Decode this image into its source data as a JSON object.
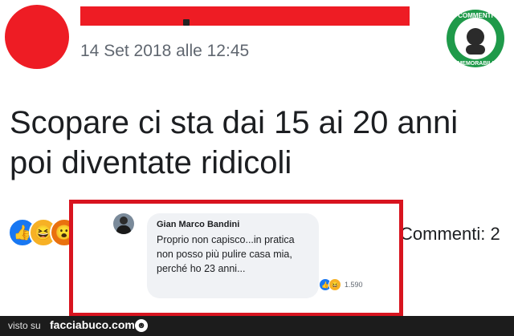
{
  "post": {
    "date": "14 Set 2018 alle 12:45",
    "text_line1": "Scopare ci sta dai 15 ai 20 anni",
    "text_line2": "poi diventate ridicoli",
    "comments_count": "Commenti: 2"
  },
  "logo": {
    "top_text": "COMMENTI",
    "bottom_text": "MEMORABILI",
    "bg_color": "#1f9a4a"
  },
  "comment": {
    "author": "Gian Marco Bandini",
    "text": "Proprio non capisco...in pratica non posso più pulire casa mia, perché ho 23 anni...",
    "reactions_count": "1.590"
  },
  "icons": {
    "like": "thumbs-up-icon",
    "haha": "laughing-face-icon",
    "wow": "wow-face-icon"
  },
  "footer": {
    "seen_on": "visto su",
    "brand": "facciabuco.com"
  },
  "colors": {
    "redaction": "#ee1c24",
    "highlight_border": "#d8141f",
    "like_blue": "#1877f2",
    "haha_yellow": "#f7b125"
  }
}
